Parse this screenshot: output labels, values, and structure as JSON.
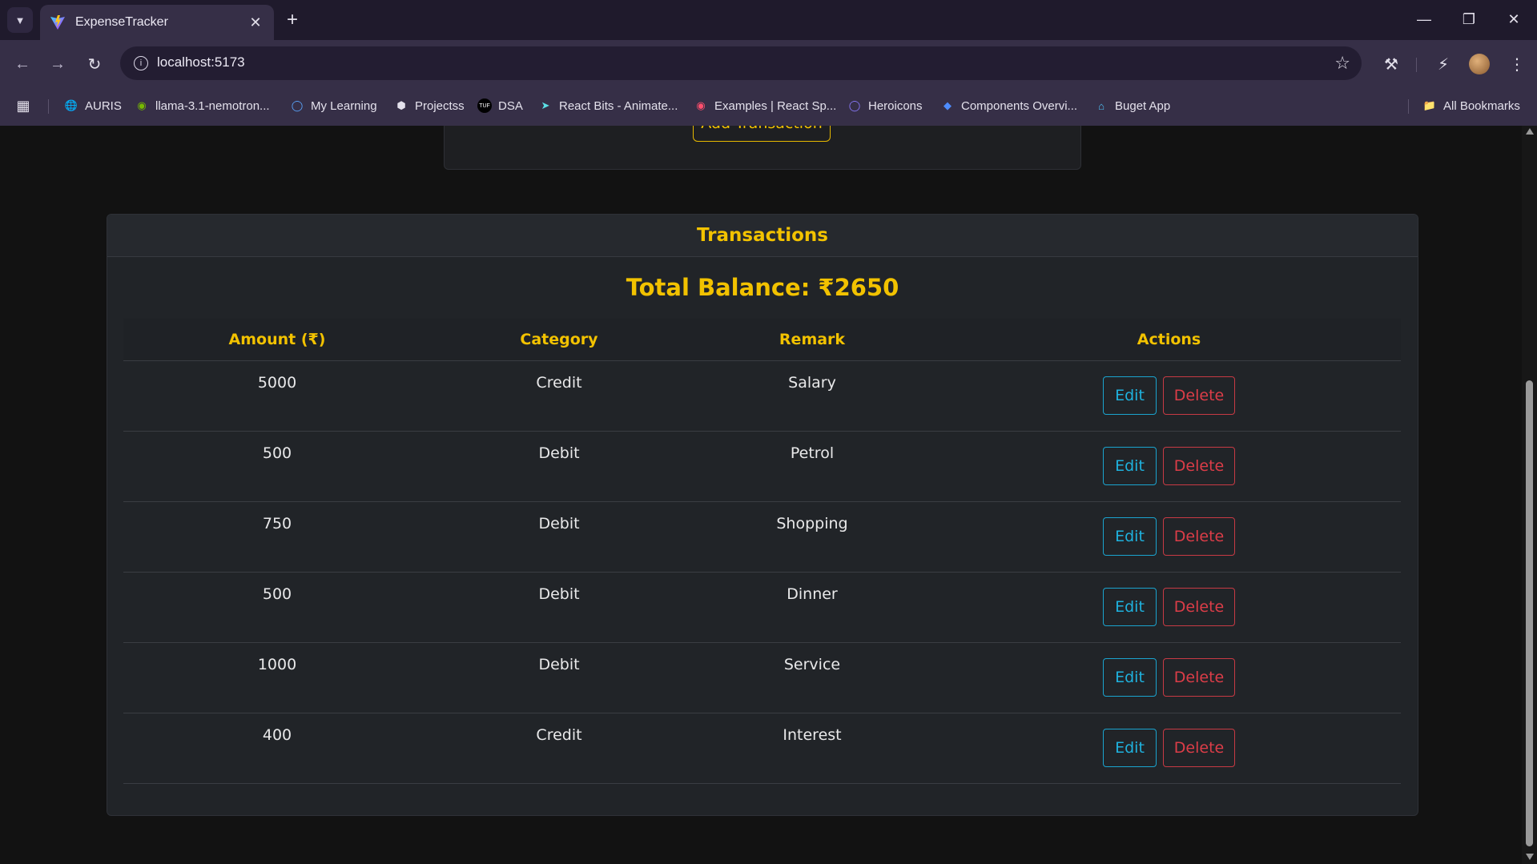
{
  "browser": {
    "tab_title": "ExpenseTracker",
    "url": "localhost:5173",
    "bookmarks": [
      {
        "label": "AURIS",
        "icon": "globe-icon"
      },
      {
        "label": "llama-3.1-nemotron...",
        "icon": "nvidia-icon"
      },
      {
        "label": "My Learning",
        "icon": "learning-icon"
      },
      {
        "label": "Projectss",
        "icon": "project-icon"
      },
      {
        "label": "DSA",
        "icon": "tuf-icon"
      },
      {
        "label": "React Bits - Animate...",
        "icon": "react-bits-icon"
      },
      {
        "label": "Examples | React Sp...",
        "icon": "react-spring-icon"
      },
      {
        "label": "Heroicons",
        "icon": "shield-icon"
      },
      {
        "label": "Components Overvi...",
        "icon": "components-icon"
      },
      {
        "label": "Buget App",
        "icon": "home-icon"
      }
    ],
    "all_bookmarks": "All Bookmarks"
  },
  "form": {
    "add_button": "Add Transaction"
  },
  "transactions": {
    "title": "Transactions",
    "balance_label": "Total Balance: ₹2650",
    "columns": [
      "Amount (₹)",
      "Category",
      "Remark",
      "Actions"
    ],
    "rows": [
      {
        "amount": "5000",
        "category": "Credit",
        "remark": "Salary"
      },
      {
        "amount": "500",
        "category": "Debit",
        "remark": "Petrol"
      },
      {
        "amount": "750",
        "category": "Debit",
        "remark": "Shopping"
      },
      {
        "amount": "500",
        "category": "Debit",
        "remark": "Dinner"
      },
      {
        "amount": "1000",
        "category": "Debit",
        "remark": "Service"
      },
      {
        "amount": "400",
        "category": "Credit",
        "remark": "Interest"
      }
    ],
    "edit_label": "Edit",
    "delete_label": "Delete"
  },
  "colors": {
    "accent": "#f2c200",
    "edit": "#1fb2de",
    "delete": "#dc3d48",
    "background": "#121212",
    "card": "#212428"
  }
}
